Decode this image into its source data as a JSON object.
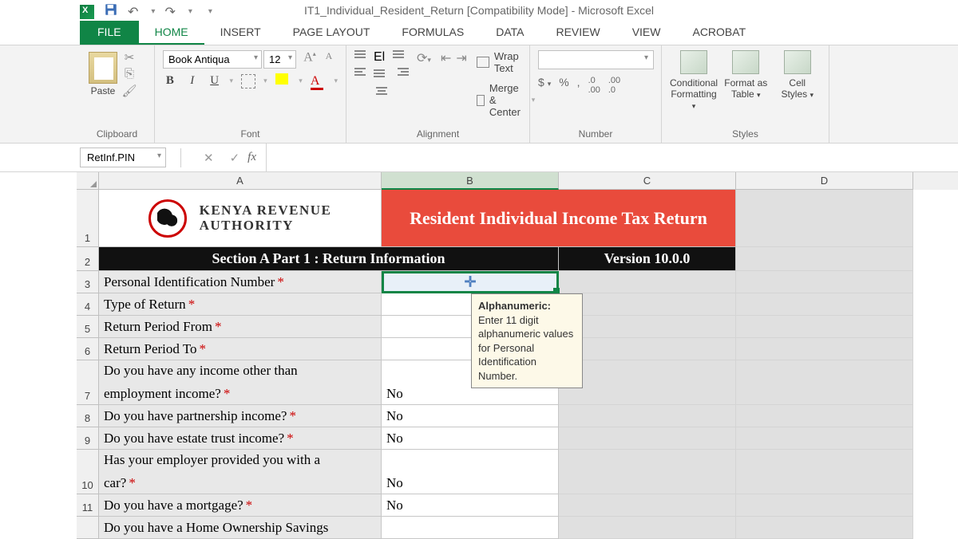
{
  "title": "IT1_Individual_Resident_Return  [Compatibility Mode] - Microsoft Excel",
  "tabs": {
    "file": "FILE",
    "home": "HOME",
    "insert": "INSERT",
    "pagelayout": "PAGE LAYOUT",
    "formulas": "FORMULAS",
    "data": "DATA",
    "review": "REVIEW",
    "view": "VIEW",
    "acrobat": "ACROBAT"
  },
  "ribbon": {
    "clipboard": {
      "paste": "Paste",
      "label": "Clipboard"
    },
    "font": {
      "name": "Book Antiqua",
      "size": "12",
      "label": "Font"
    },
    "alignment": {
      "wrap": "Wrap Text",
      "merge": "Merge & Center",
      "label": "Alignment"
    },
    "number": {
      "label": "Number"
    },
    "styles": {
      "cond": "Conditional Formatting",
      "table": "Format as Table",
      "cell": "Cell Styles",
      "label": "Styles"
    }
  },
  "namebox": "RetInf.PIN",
  "cols": {
    "a": "A",
    "b": "B",
    "c": "C",
    "d": "D"
  },
  "rownums": {
    "r1": "1",
    "r2": "2",
    "r3": "3",
    "r4": "4",
    "r5": "5",
    "r6": "6",
    "r7": "7",
    "r8": "8",
    "r9": "9",
    "r10": "10",
    "r11": "11"
  },
  "sheet": {
    "org1": "KENYA REVENUE",
    "org2": "AUTHORITY",
    "titleCell": "Resident Individual Income Tax Return",
    "section": "Section A Part 1 : Return Information",
    "version": "Version 10.0.0",
    "labels": {
      "pin": "Personal Identification Number",
      "type": "Type of Return",
      "from": "Return Period From",
      "to": "Return Period To",
      "q7a": "Do you have any income other than",
      "q7b": "employment income?",
      "q8": "Do you have partnership income?",
      "q9": "Do you have estate trust income?",
      "q10a": "Has your employer provided you with a",
      "q10b": "car?",
      "q11": "Do you have a mortgage?",
      "q12": "Do you have a Home Ownership Savings"
    },
    "values": {
      "q7": "No",
      "q8": "No",
      "q9": "No",
      "q10": "No",
      "q11": "No"
    },
    "no": "No"
  },
  "tooltip": {
    "title": "Alphanumeric:",
    "body": "Enter 11 digit alphanumeric values for Personal Identification Number."
  }
}
